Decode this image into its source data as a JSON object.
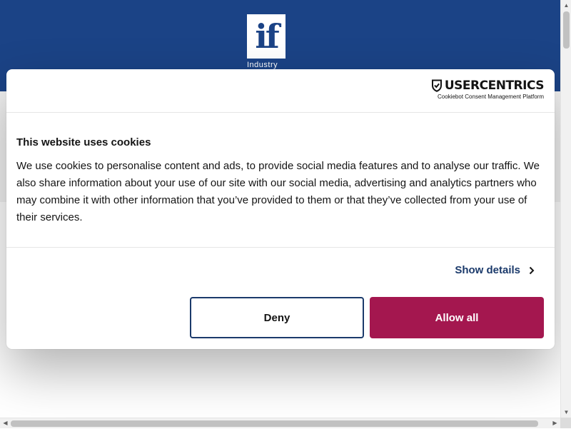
{
  "site": {
    "logo_mark": "if",
    "logo_text": "Industry"
  },
  "cookie_banner": {
    "provider_name": "USERCENTRICS",
    "provider_tagline": "Cookiebot Consent Management Platform",
    "title": "This website uses cookies",
    "body": "We use cookies to personalise content and ads, to provide social media features and to analyse our traffic. We also share information about your use of our site with our social media, advertising and analytics partners who may combine it with other information that you’ve provided to them or that they’ve collected from your use of their services.",
    "show_details_label": "Show details",
    "deny_label": "Deny",
    "allow_all_label": "Allow all"
  },
  "colors": {
    "header_blue": "#1b4386",
    "link_navy": "#1b3a6b",
    "allow_magenta": "#a4174f"
  },
  "icons": {
    "shield": "usercentrics-shield-icon",
    "details": "chevron-right-icon"
  }
}
